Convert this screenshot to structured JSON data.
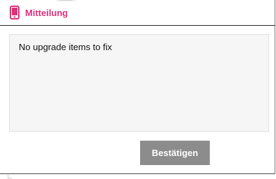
{
  "dialog": {
    "title": "Mitteilung",
    "title_icon": "mobile-phone-icon",
    "message": "No upgrade items to fix",
    "confirm_label": "Bestätigen"
  },
  "colors": {
    "accent": "#e0307a",
    "button_bg": "#8c8c8c",
    "button_text": "#ffffff",
    "message_bg": "#f6f6f6"
  }
}
